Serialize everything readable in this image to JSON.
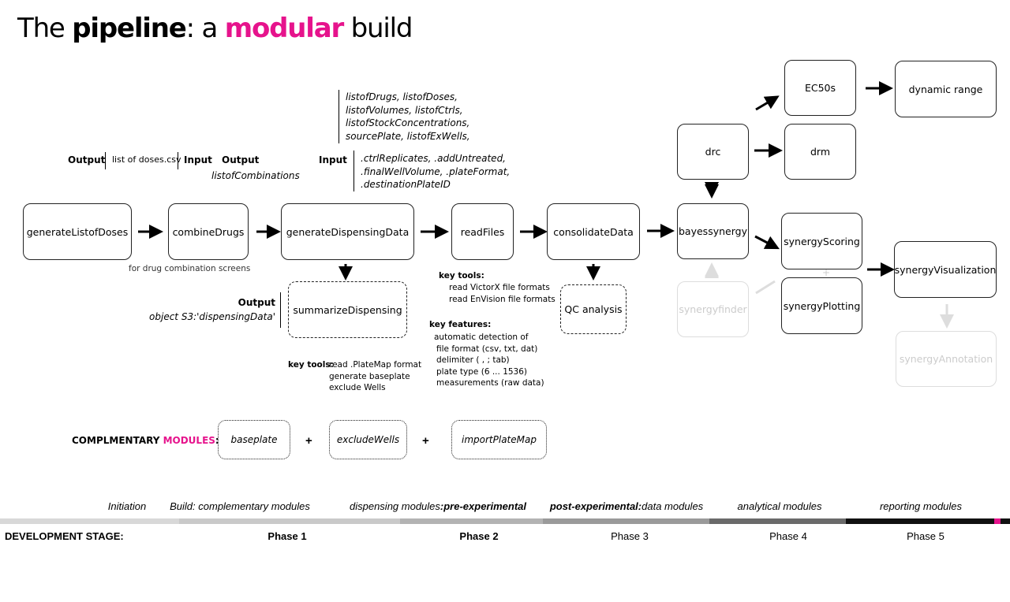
{
  "title": {
    "part1": "The ",
    "part2": "pipeline",
    "part3": ": a ",
    "part4": "modular",
    "part5": " build"
  },
  "colors": {
    "accent": "#e6138c",
    "faint": "#cccccc"
  },
  "nodes": {
    "generateListofDoses": "generateListofDoses",
    "combineDrugs": "combineDrugs",
    "generateDispensingData": "generateDispensingData",
    "readFiles": "readFiles",
    "consolidateData": "consolidateData",
    "bayessynergy": "bayessynergy",
    "drc": "drc",
    "ec50s": "EC50s",
    "drm": "drm",
    "dynamicRange": "dynamic range",
    "synergyScoring": "synergyScoring",
    "synergyPlotting": "synergyPlotting",
    "synergyVisualization": "synergyVisualization",
    "synergyfinder": "synergyfinder",
    "synergyAnnotation": "synergyAnnotation",
    "summarizeDispensing": "summarizeDispensing",
    "qcAnalysis": "QC analysis"
  },
  "annotations": {
    "output1": "Output",
    "listOfDosesCsv": "list of doses.csv",
    "input1": "Input",
    "output2": "Output",
    "listofCombinations": "listofCombinations",
    "input2": "Input",
    "inputList1": [
      "listofDrugs, listofDoses,",
      "listofVolumes, listofCtrls,",
      "listofStockConcentrations,",
      "sourcePlate, listofExWells,"
    ],
    "inputList2": [
      ".ctrlReplicates, .addUntreated,",
      ".finalWellVolume, .plateFormat,",
      ".destinationPlateID"
    ],
    "forDrugCombination": "for drug combination screens",
    "output3": "Output",
    "objectS3": "object S3:'dispensingData'",
    "keyTools1Label": "key tools:",
    "keyTools1": [
      "read .PlateMap format",
      "generate baseplate",
      "exclude Wells"
    ],
    "keyTools2Label": "key tools:",
    "keyTools2": [
      "read VictorX file formats",
      "read EnVision file formats"
    ],
    "keyFeaturesLabel": "key features:",
    "keyFeatures": [
      "automatic detection of",
      "file format (csv, txt, dat)",
      "delimiter ( , ; tab)",
      "plate type (6 ... 1536)",
      "measurements (raw data)"
    ]
  },
  "complementary": {
    "label1": "COMPLMENTARY ",
    "label2": "MODULES",
    "label3": ":",
    "modules": [
      "baseplate",
      "excludeWells",
      "importPlateMap"
    ],
    "plus": "+"
  },
  "phases": {
    "labels": [
      {
        "text": "Initiation"
      },
      {
        "text": "Build: complementary modules"
      },
      {
        "text": "dispensing modules",
        "bold": ":pre-experimental"
      },
      {
        "bold": "post-experimental:",
        "text": "data modules"
      },
      {
        "text": "analytical modules"
      },
      {
        "text": "reporting modules"
      }
    ],
    "devStage": "DEVELOPMENT STAGE:",
    "stages": [
      "Phase 1",
      "Phase 2",
      "Phase 3",
      "Phase 4",
      "Phase 5"
    ],
    "barColors": [
      "#d8d8d8",
      "#c9c9c9",
      "#b3b3b3",
      "#9a9a9a",
      "#6a6a6a",
      "#111111",
      "#e6138c"
    ]
  }
}
